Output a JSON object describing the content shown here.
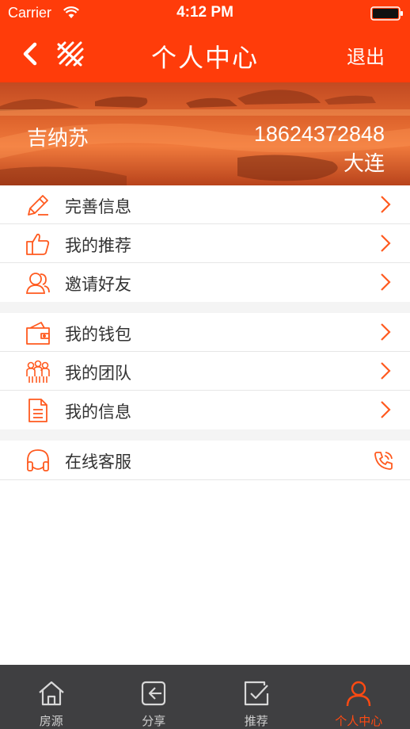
{
  "status_bar": {
    "carrier": "Carrier",
    "time": "4:12 PM"
  },
  "nav": {
    "title": "个人中心",
    "logout_label": "退出"
  },
  "profile": {
    "name": "吉纳苏",
    "phone": "18624372848",
    "city": "大连"
  },
  "menu_group_1": [
    {
      "label": "完善信息",
      "icon": "edit-icon"
    },
    {
      "label": "我的推荐",
      "icon": "thumbs-up-icon"
    },
    {
      "label": "邀请好友",
      "icon": "invite-friends-icon"
    }
  ],
  "menu_group_2": [
    {
      "label": "我的钱包",
      "icon": "wallet-icon"
    },
    {
      "label": "我的团队",
      "icon": "team-icon"
    },
    {
      "label": "我的信息",
      "icon": "document-icon"
    }
  ],
  "menu_group_3": [
    {
      "label": "在线客服",
      "icon": "headset-icon",
      "action_icon": "phone-icon"
    }
  ],
  "tabs": [
    {
      "label": "房源",
      "icon": "home-icon"
    },
    {
      "label": "分享",
      "icon": "share-icon"
    },
    {
      "label": "推荐",
      "icon": "recommend-icon"
    },
    {
      "label": "个人中心",
      "icon": "user-icon",
      "active": true
    }
  ],
  "colors": {
    "accent": "#ff3c0a",
    "icon_orange": "#ff5a1f",
    "tabbar_bg": "#3f3f41"
  }
}
